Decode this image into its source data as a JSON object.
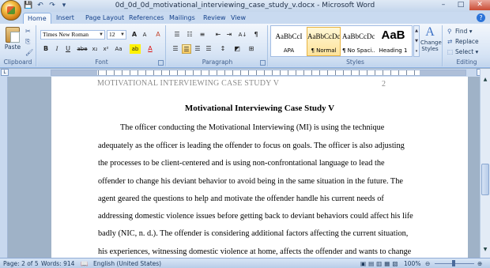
{
  "window": {
    "title": "0d_0d_0d_motivational_interviewing_case_study_v.docx - Microsoft Word",
    "minimize": "–",
    "maximize": "□",
    "close": "✕"
  },
  "quick_access": {
    "save_icon": "💾",
    "undo_icon": "↶",
    "redo_icon": "↷",
    "customize_icon": "▾"
  },
  "tabs": [
    "Home",
    "Insert",
    "Page Layout",
    "References",
    "Mailings",
    "Review",
    "View"
  ],
  "active_tab": "Home",
  "help_label": "?",
  "ribbon": {
    "clipboard": {
      "paste_label": "Paste",
      "cut_icon": "✂",
      "copy_icon": "⎘",
      "format_painter_icon": "🖌",
      "group_label": "Clipboard"
    },
    "font": {
      "font_name": "Times New Roman",
      "font_size": "12",
      "grow_label": "A",
      "shrink_label": "A",
      "clear_label": "A",
      "bold": "B",
      "italic": "I",
      "underline": "U",
      "strike": "abe",
      "subscript": "x₂",
      "superscript": "x²",
      "change_case": "Aa",
      "highlight": "ab",
      "font_color": "A",
      "group_label": "Font"
    },
    "paragraph": {
      "bullets": "☰",
      "numbering": "☷",
      "multilevel": "≡",
      "decrease_indent": "⇤",
      "increase_indent": "⇥",
      "sort": "A↓",
      "show_marks": "¶",
      "align_left": "☰",
      "center": "☰",
      "align_right": "☰",
      "justify": "☰",
      "line_spacing": "↕",
      "shading": "◩",
      "borders": "⊞",
      "group_label": "Paragraph"
    },
    "styles": {
      "items": [
        {
          "sample": "AaBbCcI",
          "name": "APA"
        },
        {
          "sample": "AaBbCcDc",
          "name": "¶ Normal"
        },
        {
          "sample": "AaBbCcDc",
          "name": "¶ No Spaci..."
        },
        {
          "sample": "AaB",
          "name": "Heading 1"
        }
      ],
      "change_styles_label": "Change Styles",
      "group_label": "Styles"
    },
    "editing": {
      "find": "Find",
      "replace": "Replace",
      "select": "Select",
      "group_label": "Editing"
    }
  },
  "document": {
    "header_text": "MOTIVATIONAL INTERVIEWING CASE STUDY V",
    "page_number": "2",
    "title": "Motivational Interviewing Case Study V",
    "lines": [
      "The officer conducting the Motivational Interviewing (MI) is using the technique",
      "adequately as the officer is leading the offender to focus on goals. The officer is also adjusting",
      "the processes to be client-centered and is using non-confrontational language to lead the",
      "offender to change his deviant behavior to avoid being in the same situation in the future. The",
      "agent geared the questions to help and motivate the offender handle his current needs of",
      "addressing domestic violence issues before getting back to deviant behaviors could affect his life",
      "badly (NIC, n. d.). The offender is considering additional factors affecting the current situation,",
      "his experiences, witnessing domestic violence at home, affects the offender and wants to change"
    ]
  },
  "status": {
    "page": "Page: 2 of 5",
    "words": "Words: 914",
    "language": "English (United States)",
    "zoom": "100%",
    "zoom_out": "⊖",
    "zoom_in": "⊕"
  }
}
